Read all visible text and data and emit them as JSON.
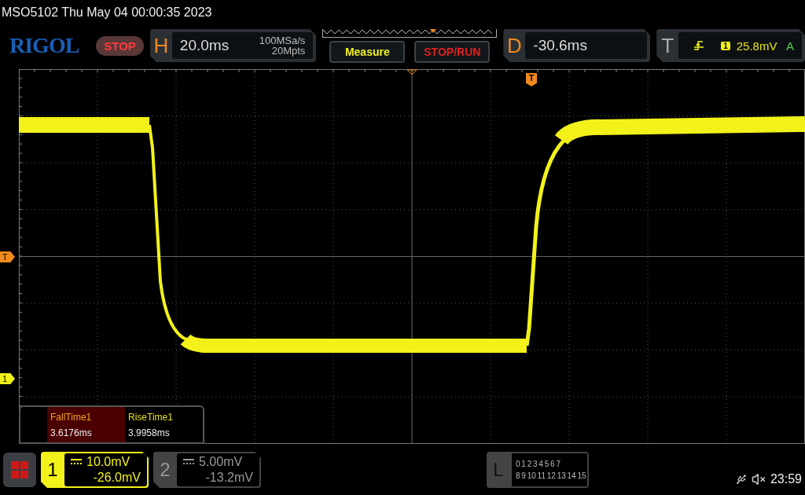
{
  "title": "MSO5102  Thu May 04 00:00:35 2023",
  "logo": "RIGOL",
  "run_state": "STOP",
  "horizontal": {
    "label": "H",
    "timebase": "20.0ms",
    "sample_rate": "100MSa/s",
    "memory": "20Mpts"
  },
  "buttons": [
    {
      "label": "Measure",
      "kind": "measure"
    },
    {
      "label": "STOP/RUN",
      "kind": "run"
    }
  ],
  "delay": {
    "label": "D",
    "value": "-30.6ms"
  },
  "trigger": {
    "label": "T",
    "channel": "1",
    "level": "25.8mV",
    "mode": "A"
  },
  "plot_markers": {
    "trigger_top": "T",
    "trigger_level": "T",
    "channel": "1"
  },
  "measurements": [
    {
      "name": "FallTime1",
      "value": "3.6176ms",
      "selected": true
    },
    {
      "name": "RiseTime1",
      "value": "3.9958ms",
      "selected": false
    }
  ],
  "channels": [
    {
      "number": "1",
      "scale": "10.0mV",
      "offset": "-26.0mV",
      "selected": true
    },
    {
      "number": "2",
      "scale": "5.00mV",
      "offset": "-13.2mV",
      "selected": false
    }
  ],
  "logic": {
    "label": "L",
    "rows": [
      "0 1 2 3 4 5 6 7",
      "8 9 10 11 12 13 14 15"
    ]
  },
  "clock": "23:59"
}
